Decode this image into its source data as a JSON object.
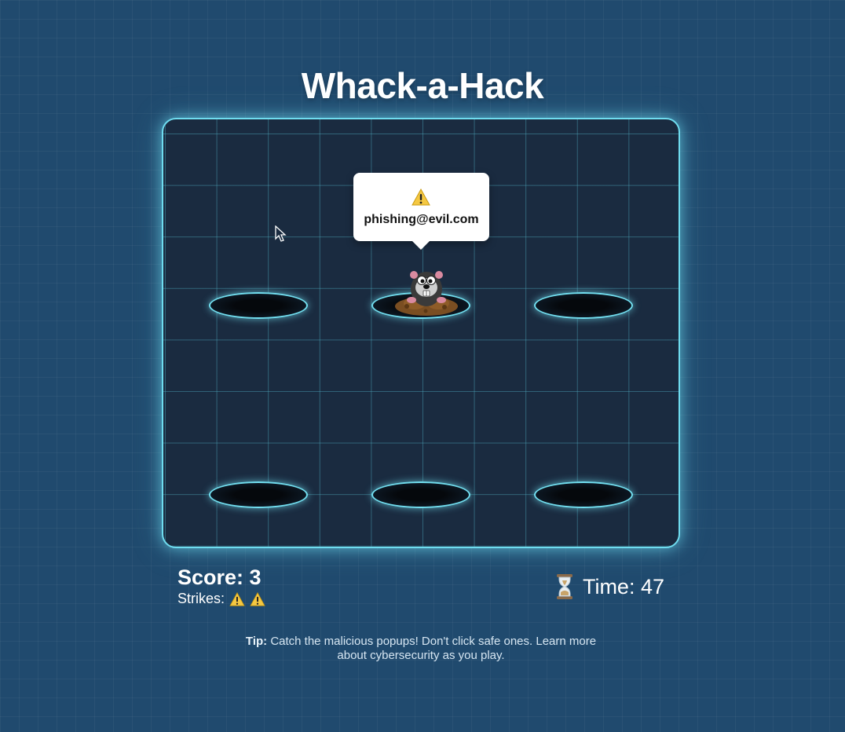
{
  "game": {
    "title": "Whack-a-Hack"
  },
  "popup": {
    "icon": "warning-icon",
    "text": "phishing@evil.com"
  },
  "holes": [
    {
      "name": "hole-1",
      "occupied": false
    },
    {
      "name": "hole-2",
      "occupied": true
    },
    {
      "name": "hole-3",
      "occupied": false
    },
    {
      "name": "hole-4",
      "occupied": false
    },
    {
      "name": "hole-5",
      "occupied": false
    },
    {
      "name": "hole-6",
      "occupied": false
    }
  ],
  "status": {
    "score_label": "Score: 3",
    "strikes_label": "Strikes:",
    "strike_icons": [
      "warning-icon",
      "warning-icon"
    ],
    "timer_icon": "hourglass-icon",
    "time_label": "Time: 47"
  },
  "tip": {
    "prefix": "Tip:",
    "text": "Catch the malicious popups! Don't click safe ones. Learn more about cybersecurity as you play."
  },
  "colors": {
    "background": "#204a6e",
    "board": "#1a2b40",
    "accent": "#6fdcef",
    "warning": "#f5c842"
  }
}
